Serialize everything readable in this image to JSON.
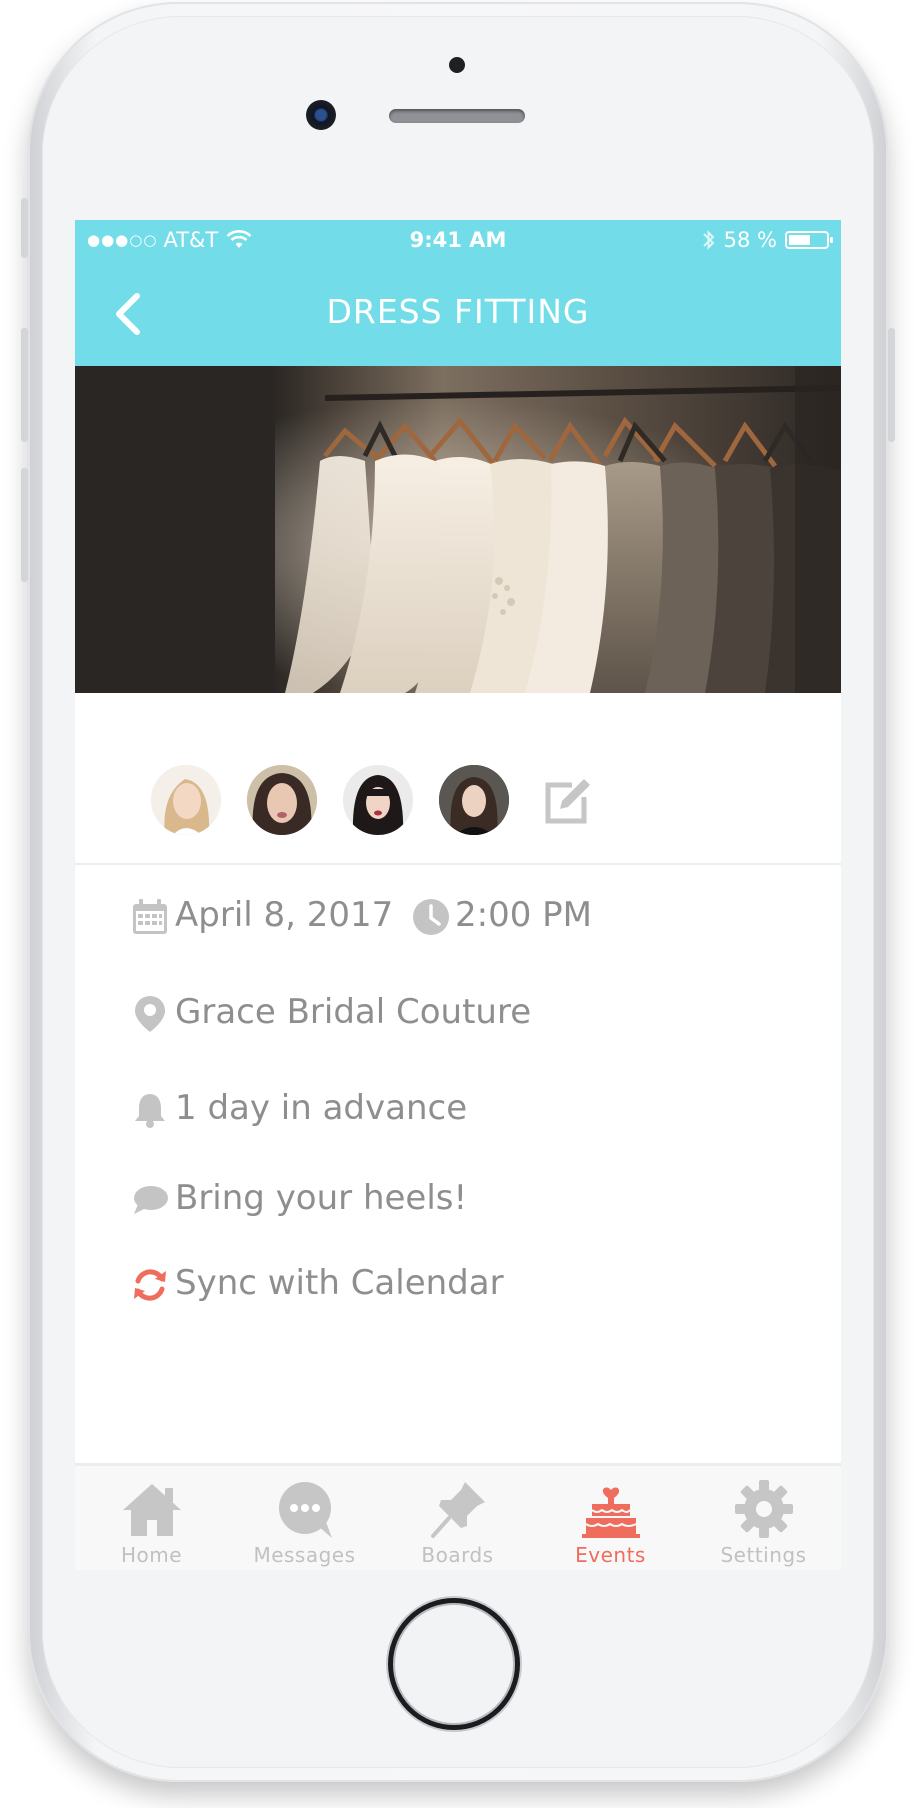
{
  "status_bar": {
    "signal": "●●●○○",
    "carrier": "AT&T",
    "time": "9:41 AM",
    "battery": "58 %",
    "battery_level": 0.58
  },
  "nav": {
    "title": "DRESS FITTING"
  },
  "details": {
    "date": "April 8, 2017",
    "time": "2:00 PM",
    "location": "Grace Bridal Couture",
    "reminder": "1 day in advance",
    "note": "Bring your heels!",
    "sync": "Sync with Calendar"
  },
  "tabs": [
    {
      "label": "Home",
      "icon": "home-icon"
    },
    {
      "label": "Messages",
      "icon": "chat-bubble-icon"
    },
    {
      "label": "Boards",
      "icon": "pushpin-icon"
    },
    {
      "label": "Events",
      "icon": "cake-icon",
      "active": true
    },
    {
      "label": "Settings",
      "icon": "gear-icon"
    }
  ],
  "colors": {
    "accent": "#72dde8",
    "active_tab": "#ef6d5c",
    "inactive_tab": "#c1c1c1",
    "detail_text": "#8e8e8e",
    "sync_icon": "#ef6d5c"
  }
}
